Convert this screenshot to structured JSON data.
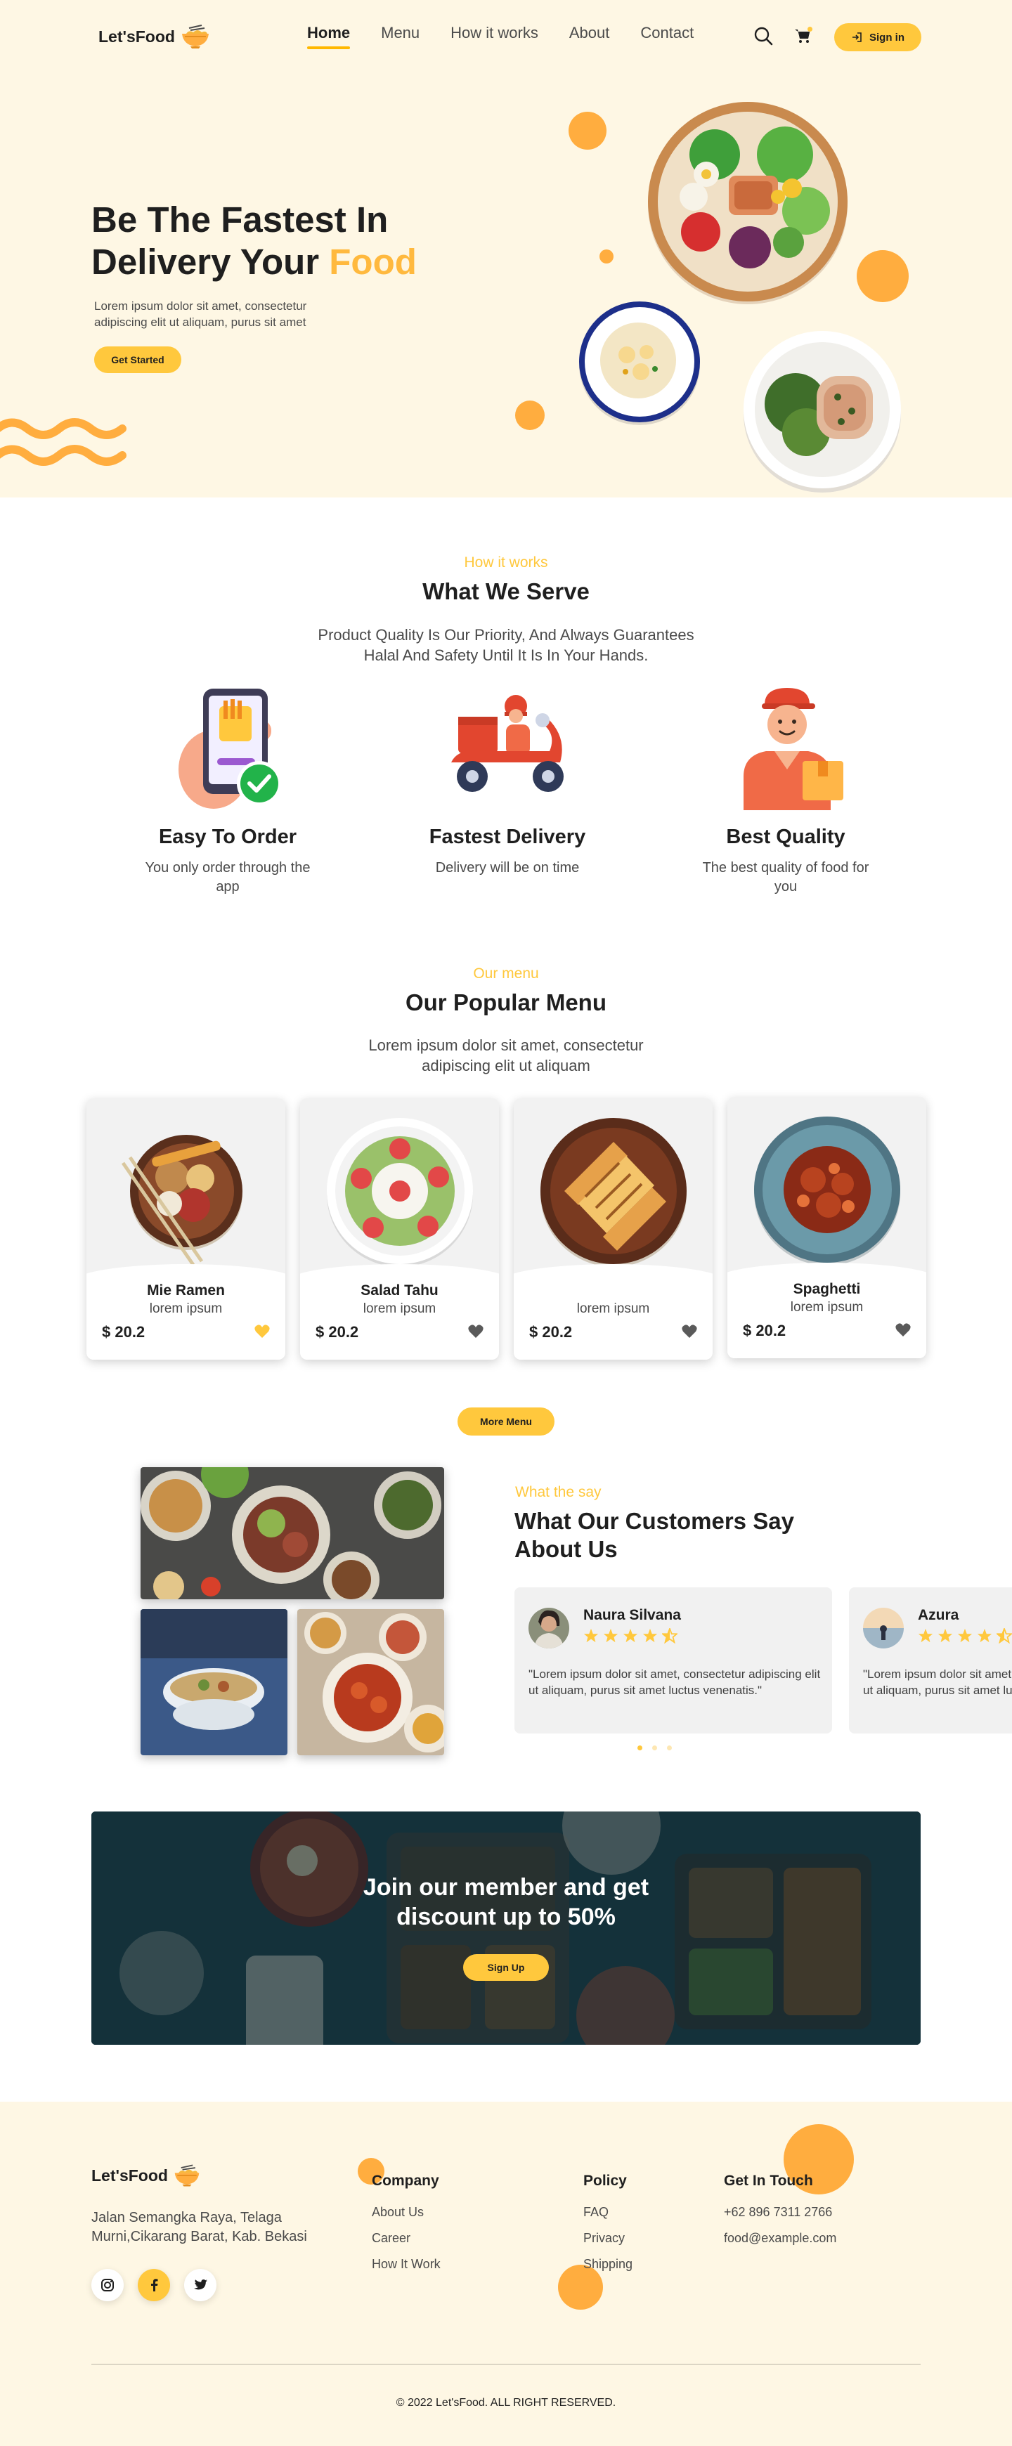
{
  "brand": {
    "name": "Let'sFood",
    "accent": "#ffc83d",
    "orange": "#ffad3f",
    "cream": "#fef7e4"
  },
  "nav": {
    "links": [
      "Home",
      "Menu",
      "How it works",
      "About",
      "Contact"
    ],
    "active": "Home",
    "signin_label": "Sign in",
    "icons": [
      "search-icon",
      "cart-icon",
      "login-icon"
    ]
  },
  "hero": {
    "title_line1": "Be The Fastest In",
    "title_line2_prefix": "Delivery Your ",
    "title_highlight": "Food",
    "subtitle": "Lorem ipsum dolor sit amet, consectetur adipiscing elit ut aliquam, purus sit amet",
    "cta_label": "Get Started"
  },
  "how": {
    "eyebrow": "How it works",
    "title": "What We Serve",
    "subtitle_line1": "Product Quality Is Our Priority, And Always Guarantees",
    "subtitle_line2": "Halal And Safety Until It Is In Your Hands.",
    "features": [
      {
        "title": "Easy To Order",
        "desc": "You only order through the app",
        "icon": "phone-order-icon"
      },
      {
        "title": "Fastest Delivery",
        "desc": "Delivery will be on time",
        "icon": "scooter-delivery-icon"
      },
      {
        "title": "Best Quality",
        "desc": "The best quality of food for you",
        "icon": "courier-package-icon"
      }
    ]
  },
  "menu": {
    "eyebrow": "Our menu",
    "title": "Our Popular Menu",
    "subtitle_line1": "Lorem ipsum dolor sit amet, consectetur",
    "subtitle_line2": "adipiscing elit ut aliquam",
    "items": [
      {
        "name": "Mie Ramen",
        "desc": "lorem ipsum",
        "price": "$ 20.2",
        "favorite": true
      },
      {
        "name": "Salad Tahu",
        "desc": "lorem ipsum",
        "price": "$ 20.2",
        "favorite": false
      },
      {
        "name": "",
        "desc": "lorem ipsum",
        "price": "$ 20.2",
        "favorite": false
      },
      {
        "name": "Spaghetti",
        "desc": "lorem ipsum",
        "price": "$ 20.2",
        "favorite": false
      }
    ],
    "more_label": "More Menu"
  },
  "reviews": {
    "eyebrow": "What the say",
    "title_line1": "What Our Customers Say",
    "title_line2": "About Us",
    "items": [
      {
        "name": "Naura Silvana",
        "rating": 4.5,
        "text": "\"Lorem ipsum dolor sit amet, consectetur adipiscing elit ut aliquam, purus sit amet luctus venenatis.\""
      },
      {
        "name": "Azura",
        "rating": 4.5,
        "text": "\"Lorem ipsum dolor sit amet, consectetur adipiscing elit ut aliquam, purus sit amet luctus venenatis.\""
      }
    ],
    "active_dot": 0,
    "dot_count": 3
  },
  "banner": {
    "title_line1": "Join our member and get",
    "title_line2": "discount up to 50%",
    "cta_label": "Sign Up"
  },
  "footer": {
    "brand": "Let'sFood",
    "address": "Jalan Semangka Raya, Telaga Murni,Cikarang Barat, Kab. Bekasi",
    "socials": [
      "instagram-icon",
      "facebook-icon",
      "twitter-icon"
    ],
    "columns": [
      {
        "title": "Company",
        "links": [
          "About Us",
          "Career",
          "How It Work"
        ]
      },
      {
        "title": "Policy",
        "links": [
          "FAQ",
          "Privacy",
          "Shipping"
        ]
      },
      {
        "title": "Get In Touch",
        "links": [
          "+62 896 7311 2766",
          "food@example.com"
        ]
      }
    ],
    "copyright": "© 2022 Let'sFood. ALL RIGHT RESERVED."
  }
}
